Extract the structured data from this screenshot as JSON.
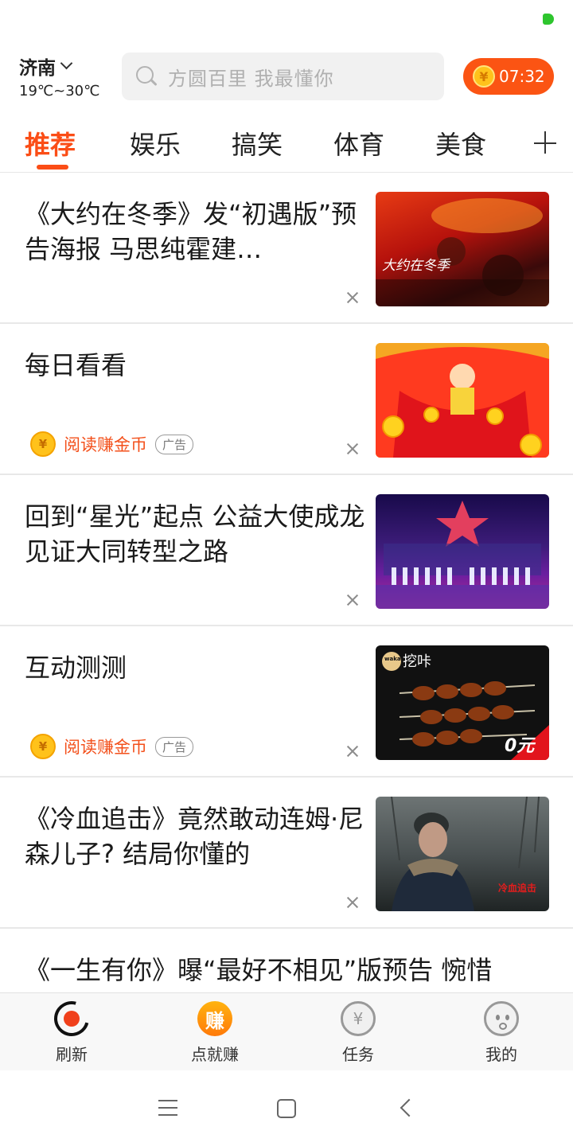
{
  "header": {
    "city": "济南",
    "temperature": "19℃~30℃",
    "search_placeholder": "方圆百里 我最懂你",
    "coin_symbol": "¥",
    "timer": "07:32"
  },
  "tabs": [
    "推荐",
    "娱乐",
    "搞笑",
    "体育",
    "美食"
  ],
  "active_tab": "推荐",
  "feed": [
    {
      "title": "《大约在冬季》发“初遇版”预告海报 马思纯霍建…",
      "thumb_caption": "大约在冬季",
      "type": "news"
    },
    {
      "title": "每日看看",
      "type": "ad",
      "ad_text": "阅读赚金币",
      "ad_badge": "广告"
    },
    {
      "title": "回到“星光”起点 公益大使成龙见证大同转型之路",
      "type": "news"
    },
    {
      "title": "互动测测",
      "type": "ad",
      "ad_text": "阅读赚金币",
      "ad_badge": "广告",
      "thumb_brand": "挖咔",
      "thumb_logo": "waka",
      "thumb_price": "0元"
    },
    {
      "title": "《冷血追击》竟然敢动连姆·尼森儿子? 结局你懂的",
      "type": "news",
      "thumb_caption": "冷血追击"
    },
    {
      "title": "《一生有你》曝“最好不相见”版预告 惋惜",
      "type": "news"
    }
  ],
  "bottom_nav": {
    "refresh": "刷新",
    "earn": "点就赚",
    "earn_icon_text": "赚",
    "tasks": "任务",
    "task_icon_text": "¥",
    "me": "我的"
  },
  "colors": {
    "accent": "#fb4d16",
    "status_dot": "#2ec52e"
  }
}
